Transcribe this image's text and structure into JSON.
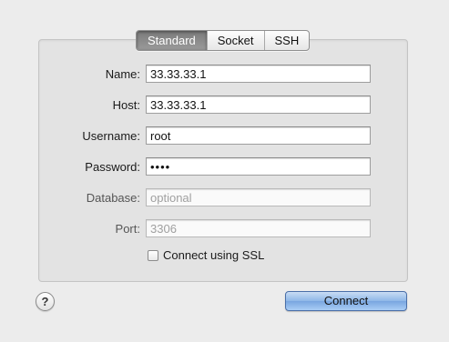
{
  "tabs": [
    {
      "label": "Standard",
      "active": true
    },
    {
      "label": "Socket",
      "active": false
    },
    {
      "label": "SSH",
      "active": false
    }
  ],
  "form": {
    "name": {
      "label": "Name:",
      "value": "33.33.33.1",
      "placeholder": ""
    },
    "host": {
      "label": "Host:",
      "value": "33.33.33.1",
      "placeholder": ""
    },
    "username": {
      "label": "Username:",
      "value": "root",
      "placeholder": ""
    },
    "password": {
      "label": "Password:",
      "value": "••••",
      "placeholder": ""
    },
    "database": {
      "label": "Database:",
      "value": "",
      "placeholder": "optional"
    },
    "port": {
      "label": "Port:",
      "value": "",
      "placeholder": "3306"
    }
  },
  "ssl": {
    "label": "Connect using SSL",
    "checked": false
  },
  "help": {
    "glyph": "?",
    "icon": "help-icon"
  },
  "connect_button": {
    "label": "Connect"
  },
  "colors": {
    "background": "#ececec",
    "active_tab": "#8a8a8a",
    "connect_button": "#8eb7e8"
  }
}
